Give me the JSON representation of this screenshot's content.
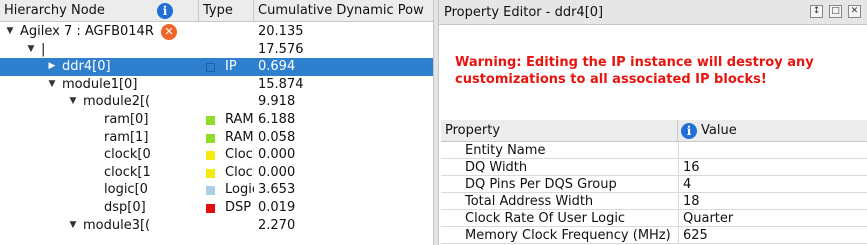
{
  "hierarchy": {
    "columns": {
      "node": "Hierarchy Node",
      "type": "Type",
      "power": "Cumulative Dynamic Pow"
    },
    "rows": [
      {
        "indent": 0,
        "arrow": "expanded",
        "label": "Agilex 7 : AGFB014R",
        "type": "",
        "type_color": "",
        "power": "20.135",
        "error_icon": true,
        "selected": false
      },
      {
        "indent": 1,
        "arrow": "expanded",
        "label": "|",
        "type": "",
        "type_color": "",
        "power": "17.576",
        "error_icon": false,
        "selected": false
      },
      {
        "indent": 2,
        "arrow": "collapsed",
        "label": "ddr4[0]",
        "type": "IP",
        "type_color": "#2f7fcf",
        "power": "0.694",
        "error_icon": false,
        "selected": true
      },
      {
        "indent": 2,
        "arrow": "expanded",
        "label": "module1[0]",
        "type": "",
        "type_color": "",
        "power": "15.874",
        "error_icon": false,
        "selected": false
      },
      {
        "indent": 3,
        "arrow": "expanded",
        "label": "module2[(",
        "type": "",
        "type_color": "",
        "power": "9.918",
        "error_icon": false,
        "selected": false
      },
      {
        "indent": 4,
        "arrow": "none",
        "label": "ram[0]",
        "type": "RAM",
        "type_color": "#8fdc2a",
        "power": "6.188",
        "error_icon": false,
        "selected": false
      },
      {
        "indent": 4,
        "arrow": "none",
        "label": "ram[1]",
        "type": "RAM",
        "type_color": "#8fdc2a",
        "power": "0.058",
        "error_icon": false,
        "selected": false
      },
      {
        "indent": 4,
        "arrow": "none",
        "label": "clock[0",
        "type": "Clock",
        "type_color": "#f4ea0c",
        "power": "0.000",
        "error_icon": false,
        "selected": false
      },
      {
        "indent": 4,
        "arrow": "none",
        "label": "clock[1",
        "type": "Clock",
        "type_color": "#f4ea0c",
        "power": "0.000",
        "error_icon": false,
        "selected": false
      },
      {
        "indent": 4,
        "arrow": "none",
        "label": "logic[0",
        "type": "Logic",
        "type_color": "#a9cfe6",
        "power": "3.653",
        "error_icon": false,
        "selected": false
      },
      {
        "indent": 4,
        "arrow": "none",
        "label": "dsp[0]",
        "type": "DSP",
        "type_color": "#e01010",
        "power": "0.019",
        "error_icon": false,
        "selected": false
      },
      {
        "indent": 3,
        "arrow": "expanded",
        "label": "module3[(",
        "type": "",
        "type_color": "",
        "power": "2.270",
        "error_icon": false,
        "selected": false
      }
    ]
  },
  "property_editor": {
    "title": "Property Editor - ddr4[0]",
    "window_buttons": [
      "pin",
      "restore",
      "close"
    ],
    "warning": "Warning: Editing the IP instance will destroy any customizations to all associated IP blocks!",
    "columns": {
      "property": "Property",
      "value": "Value"
    },
    "rows": [
      {
        "property": "Entity Name",
        "value": ""
      },
      {
        "property": "DQ Width",
        "value": "16"
      },
      {
        "property": "DQ Pins Per DQS Group",
        "value": "4"
      },
      {
        "property": "Total Address Width",
        "value": "18"
      },
      {
        "property": "Clock Rate Of User Logic",
        "value": "Quarter"
      },
      {
        "property": "Memory Clock Frequency (MHz)",
        "value": "625"
      }
    ]
  }
}
